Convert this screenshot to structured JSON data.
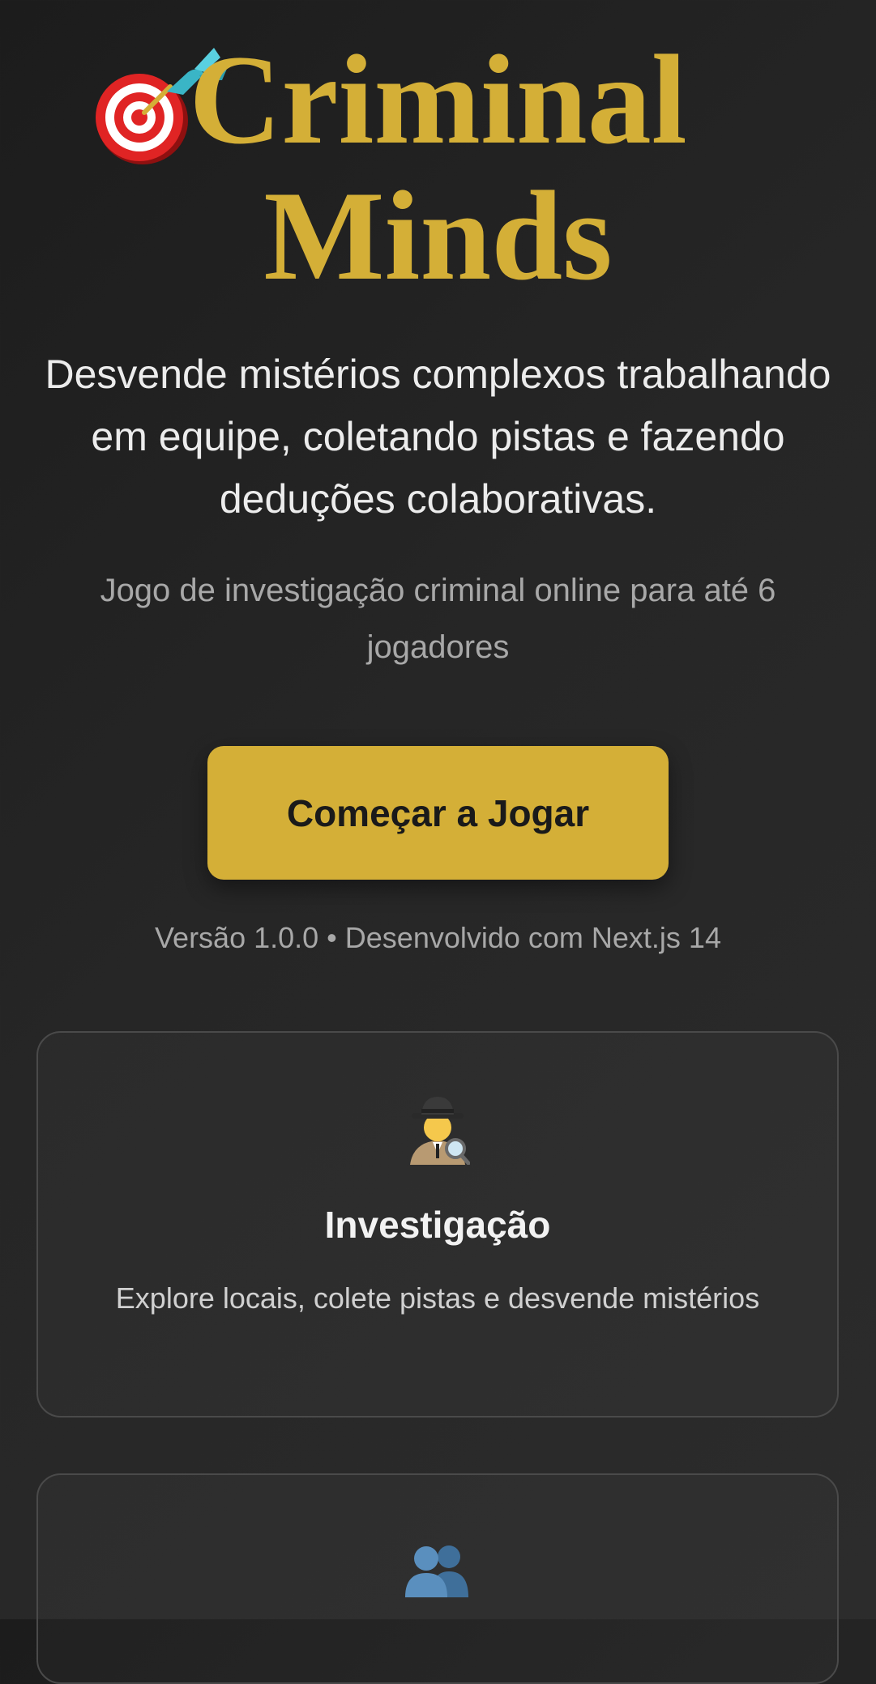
{
  "hero": {
    "title_line1": "Criminal",
    "title_line2": "Minds",
    "title_icon": "dart-target-icon",
    "subtitle": "Desvende mistérios complexos trabalhando em equipe, coletando pistas e fazendo deduções colaborativas.",
    "tagline": "Jogo de investigação criminal online para até 6 jogadores",
    "cta_label": "Começar a Jogar",
    "version_text": "Versão 1.0.0 • Desenvolvido com Next.js 14"
  },
  "features": [
    {
      "icon": "detective-icon",
      "title": "Investigação",
      "description": "Explore locais, colete pistas e desvende mistérios"
    },
    {
      "icon": "two-people-icon",
      "title": "",
      "description": ""
    }
  ],
  "colors": {
    "accent": "#d4af37",
    "background": "#222222",
    "text_primary": "#ececec",
    "text_muted": "#a8a8a8",
    "card_border": "#4a4a4a"
  }
}
